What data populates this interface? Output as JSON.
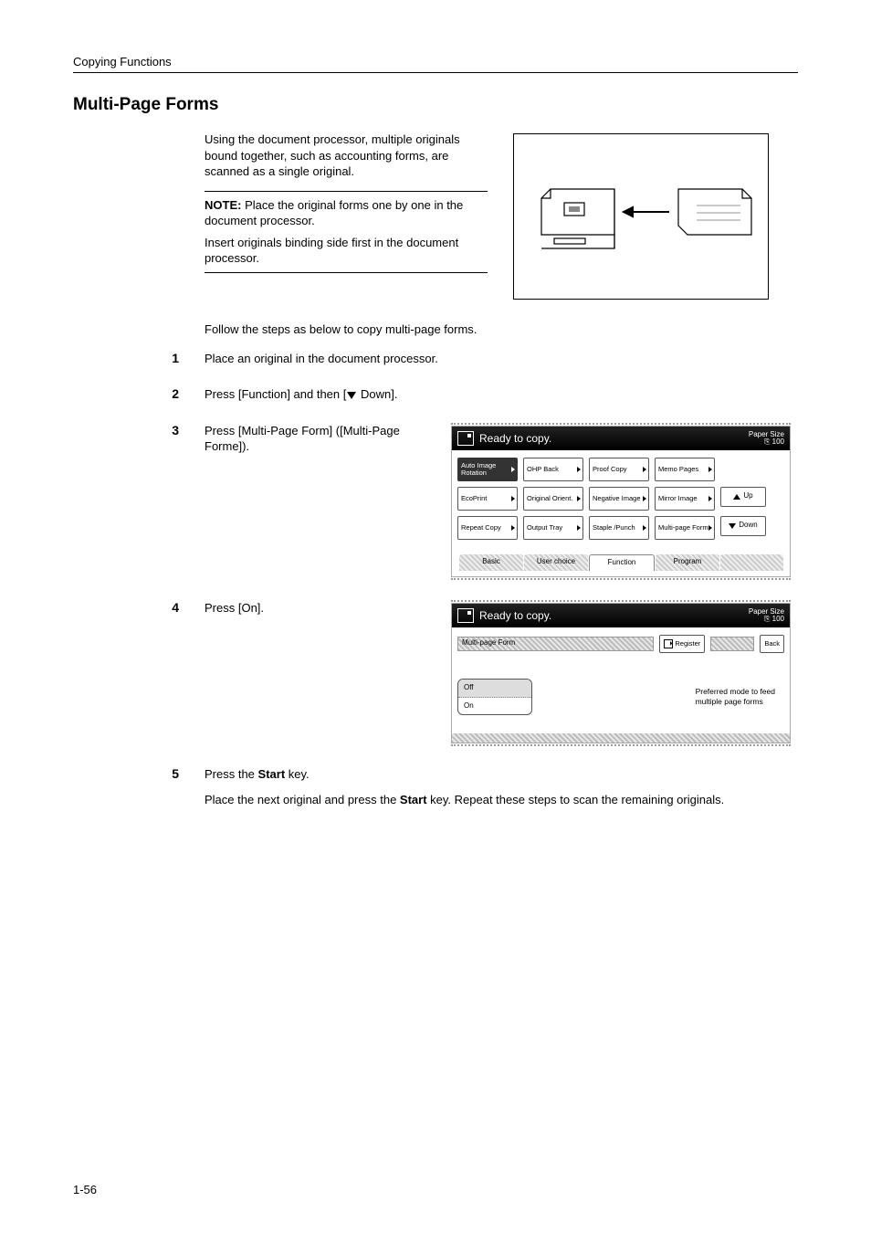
{
  "running_header": "Copying Functions",
  "title": "Multi-Page Forms",
  "intro": "Using the document processor, multiple originals bound together, such as accounting forms, are scanned as a single original.",
  "note": {
    "label": "NOTE:",
    "text1": " Place the original forms one by one in the document processor.",
    "text2": "Insert originals binding side first in the document processor."
  },
  "follow": "Follow the steps as below to copy multi-page forms.",
  "steps": {
    "s1": "Place an original in the document processor.",
    "s2_a": "Press [Function] and then [",
    "s2_b": " Down].",
    "s3": "Press [Multi-Page Form] ([Multi-Page Forme]).",
    "s4": "Press [On].",
    "s5a": "Press the ",
    "s5b": "Start",
    "s5c": " key.",
    "s5_detail_a": "Place the next original and press the ",
    "s5_detail_b": "Start",
    "s5_detail_c": " key. Repeat these steps to scan the remaining originals."
  },
  "screen1": {
    "title": "Ready to copy.",
    "paper": "Paper Size",
    "scale": "100",
    "buttons": [
      [
        "Auto Image Rotation",
        "OHP Back",
        "Proof Copy",
        "Memo Pages"
      ],
      [
        "EcoPrint",
        "Original Orient.",
        "Negative Image",
        "Mirror Image"
      ],
      [
        "Repeat Copy",
        "Output Tray",
        "Staple /Punch",
        "Multi-page Form"
      ]
    ],
    "up": "Up",
    "down": "Down",
    "tabs": [
      "Basic",
      "User choice",
      "Function",
      "Program"
    ]
  },
  "screen2": {
    "title": "Ready to copy.",
    "paper": "Paper Size",
    "scale": "100",
    "strip": "Multi-page Form",
    "register": "Register",
    "back": "Back",
    "off": "Off",
    "on": "On",
    "pref1": "Preferred mode to feed",
    "pref2": "multiple page forms"
  },
  "page_number": "1-56"
}
